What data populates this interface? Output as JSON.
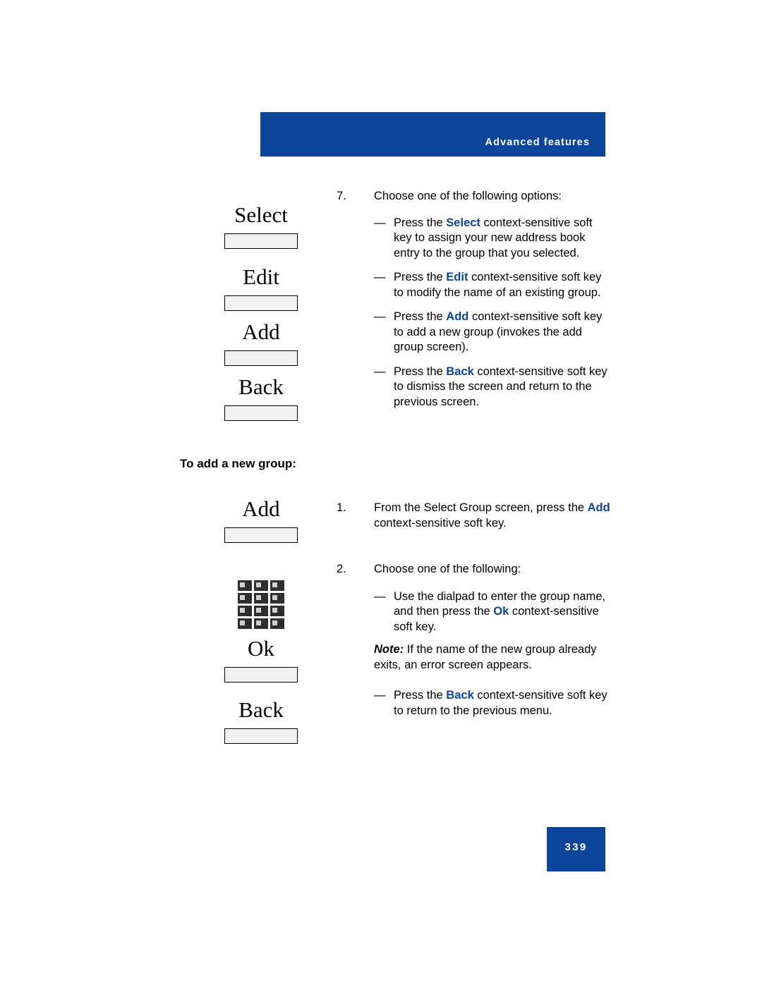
{
  "header": {
    "banner_text": "Advanced features",
    "banner_color": "#0b4499"
  },
  "footer": {
    "page_number": "339"
  },
  "section_heading": "To add a new group:",
  "softkeys_top": [
    {
      "label": "Select"
    },
    {
      "label": "Edit"
    },
    {
      "label": "Add"
    },
    {
      "label": "Back"
    }
  ],
  "softkeys_bottom": [
    {
      "label": "Add"
    },
    {
      "label": "Ok"
    },
    {
      "label": "Back"
    }
  ],
  "icons": {
    "dialpad": "dialpad-icon"
  },
  "steps_top": {
    "number": "7.",
    "intro": "Choose one of the following options:",
    "bullets": [
      {
        "dash": "—",
        "pre": "Press the ",
        "kw": "Select",
        "post": " context-sensitive soft key to assign your new address book entry to the group that you selected."
      },
      {
        "dash": "—",
        "pre": "Press the ",
        "kw": "Edit",
        "post": " context-sensitive soft key to modify the name of an existing group."
      },
      {
        "dash": "—",
        "pre": "Press the ",
        "kw": "Add",
        "post": " context-sensitive soft key to add a new group (invokes the add group screen)."
      },
      {
        "dash": "—",
        "pre": "Press the ",
        "kw": "Back",
        "post": " context-sensitive soft key to dismiss the screen and return to the previous screen."
      }
    ]
  },
  "steps_bottom": [
    {
      "number": "1.",
      "pre": "From the Select Group screen, press the ",
      "kw": "Add",
      "post": " context-sensitive soft key."
    },
    {
      "number": "2.",
      "intro": "Choose one of the following:",
      "bullets": [
        {
          "dash": "—",
          "pre": "Use the dialpad to enter the group name, and then press the ",
          "kw": "Ok",
          "post": " context-sensitive soft key."
        }
      ],
      "note": {
        "label": "Note:",
        "text": " If the name of the new group already exits, an error screen appears."
      },
      "bullets2": [
        {
          "dash": "—",
          "pre": "Press the ",
          "kw": "Back",
          "post": " context-sensitive soft key to return to the previous menu."
        }
      ]
    }
  ]
}
